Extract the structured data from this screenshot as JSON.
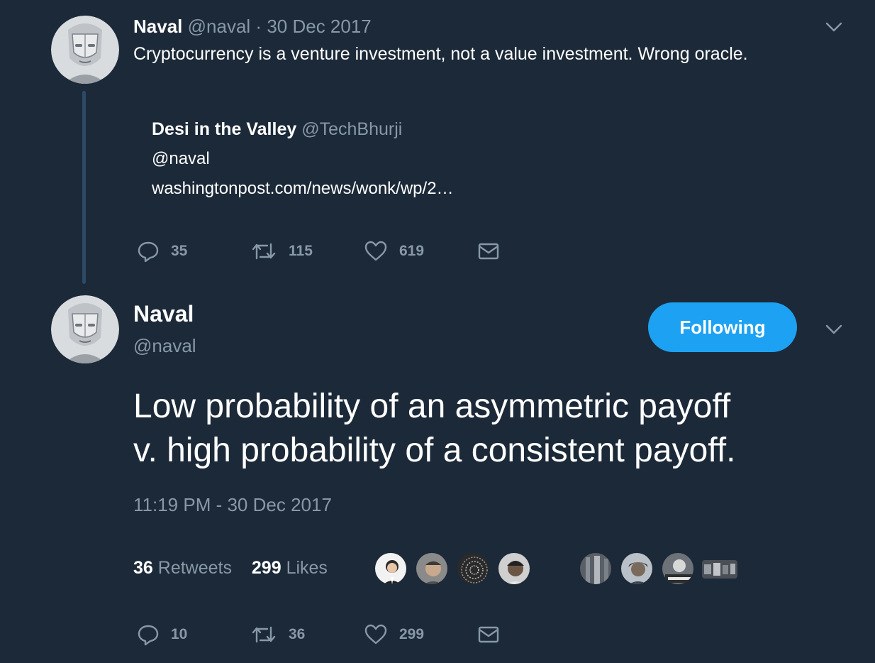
{
  "thread_tweet": {
    "author_name": "Naval",
    "handle": "@naval",
    "separator": "·",
    "date": "30 Dec 2017",
    "text": "Cryptocurrency is a venture investment, not a value investment. Wrong oracle.",
    "quoted": {
      "author_name": "Desi in the Valley",
      "handle": "@TechBhurji",
      "line1": "@naval",
      "line2": "washingtonpost.com/news/wonk/wp/2…"
    },
    "actions": {
      "replies": "35",
      "retweets": "115",
      "likes": "619"
    }
  },
  "main_tweet": {
    "author_name": "Naval",
    "handle": "@naval",
    "follow_label": "Following",
    "text_line1": "Low probability of an asymmetric payoff",
    "text_line2": "v. high probability of a consistent payoff.",
    "timestamp": "11:19 PM - 30 Dec 2017",
    "stats": {
      "retweets_count": "36",
      "retweets_label": "Retweets",
      "likes_count": "299",
      "likes_label": "Likes"
    },
    "actions": {
      "replies": "10",
      "retweets": "36",
      "likes": "299"
    }
  },
  "icons": {
    "reply": "reply-icon",
    "retweet": "retweet-icon",
    "like": "heart-icon",
    "dm": "envelope-icon",
    "menu": "chevron-down-icon"
  },
  "colors": {
    "background": "#1c2938",
    "text": "#ffffff",
    "muted": "#8899a6",
    "accent": "#1da1f2",
    "thread_line": "#2c4a66"
  }
}
